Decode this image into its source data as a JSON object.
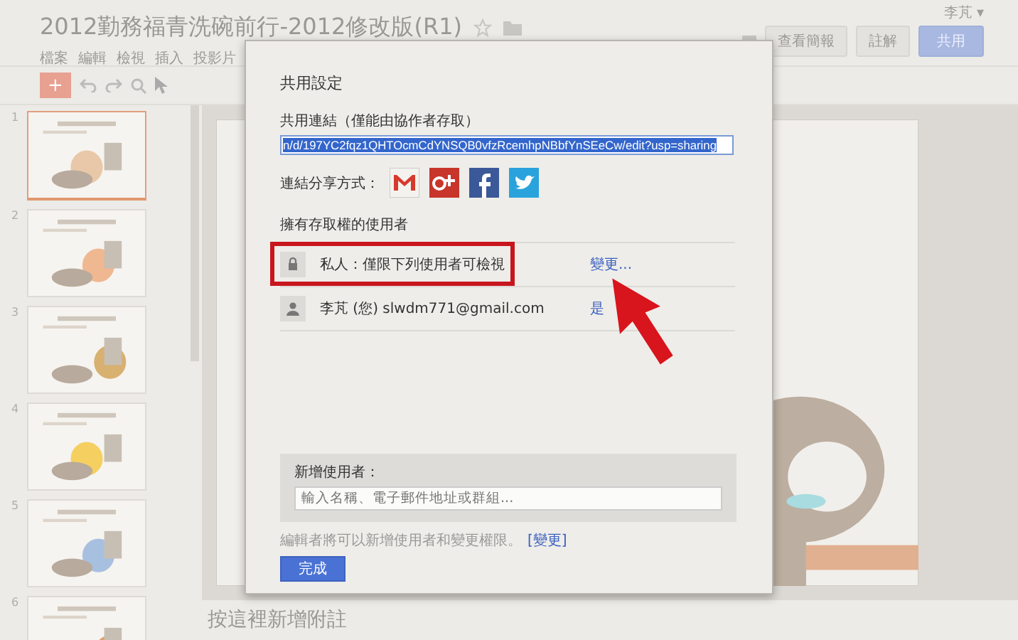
{
  "header": {
    "title": "2012勤務福青洗碗前行-2012修改版(R1)",
    "user": "李芃 ▾",
    "present_button": "查看簡報",
    "comment_button": "註解",
    "share_button": "共用"
  },
  "menu": [
    "檔案",
    "編輯",
    "檢視",
    "插入",
    "投影片"
  ],
  "toolbar": {
    "new_button": "+"
  },
  "slides": [
    {
      "number": "1",
      "selected": true
    },
    {
      "number": "2",
      "selected": false
    },
    {
      "number": "3",
      "selected": false
    },
    {
      "number": "4",
      "selected": false
    },
    {
      "number": "5",
      "selected": false
    },
    {
      "number": "6",
      "selected": false
    }
  ],
  "notes_placeholder": "按這裡新增附註",
  "dialog": {
    "title": "共用設定",
    "link_label": "共用連結（僅能由協作者存取）",
    "link_value": "n/d/197YC2fqz1QHTOcmCdYNSQB0vfzRcemhpNBbfYnSEeCw/edit?usp=sharing",
    "share_via_label": "連結分享方式：",
    "access_heading": "擁有存取權的使用者",
    "access_rows": [
      {
        "kind": "visibility",
        "text": "私人：僅限下列使用者可檢視",
        "action": "變更..."
      },
      {
        "kind": "person",
        "text": "李芃 (您) slwdm771@gmail.com",
        "action": "是"
      }
    ],
    "add_label": "新增使用者：",
    "add_placeholder": "輸入名稱、電子郵件地址或群組...",
    "editor_note": "編輯者將可以新增使用者和變更權限。",
    "editor_link": "[變更]",
    "done_button": "完成"
  }
}
